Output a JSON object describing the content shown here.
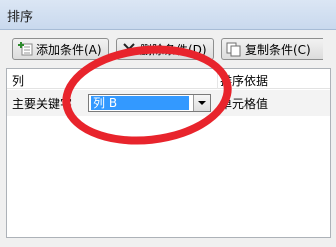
{
  "dialog": {
    "title": "排序"
  },
  "toolbar": {
    "add_label": "添加条件(A)",
    "delete_label": "删除条件(D)",
    "copy_label": "复制条件(C)"
  },
  "list": {
    "header_column": "列",
    "header_basis": "排序依据",
    "rows": [
      {
        "key_label": "主要关键字",
        "column_value": "列 B",
        "basis_value": "单元格值"
      }
    ]
  },
  "colors": {
    "selection": "#3399ff",
    "annotation_ring": "#e8242c"
  }
}
